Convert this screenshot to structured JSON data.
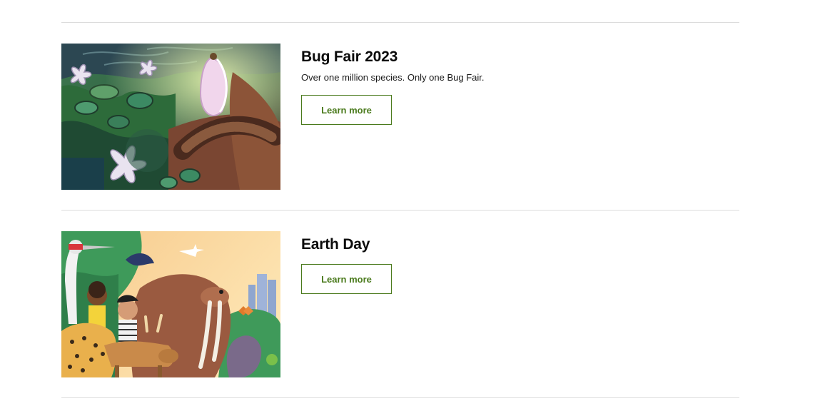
{
  "events": [
    {
      "title": "Bug Fair 2023",
      "description": "Over one million species. Only one Bug Fair.",
      "button_label": "Learn more"
    },
    {
      "title": "Earth Day",
      "description": "",
      "button_label": "Learn more"
    }
  ],
  "colors": {
    "accent": "#4a7a1c",
    "divider": "#dcdcdc",
    "title": "#0b0b0b"
  }
}
